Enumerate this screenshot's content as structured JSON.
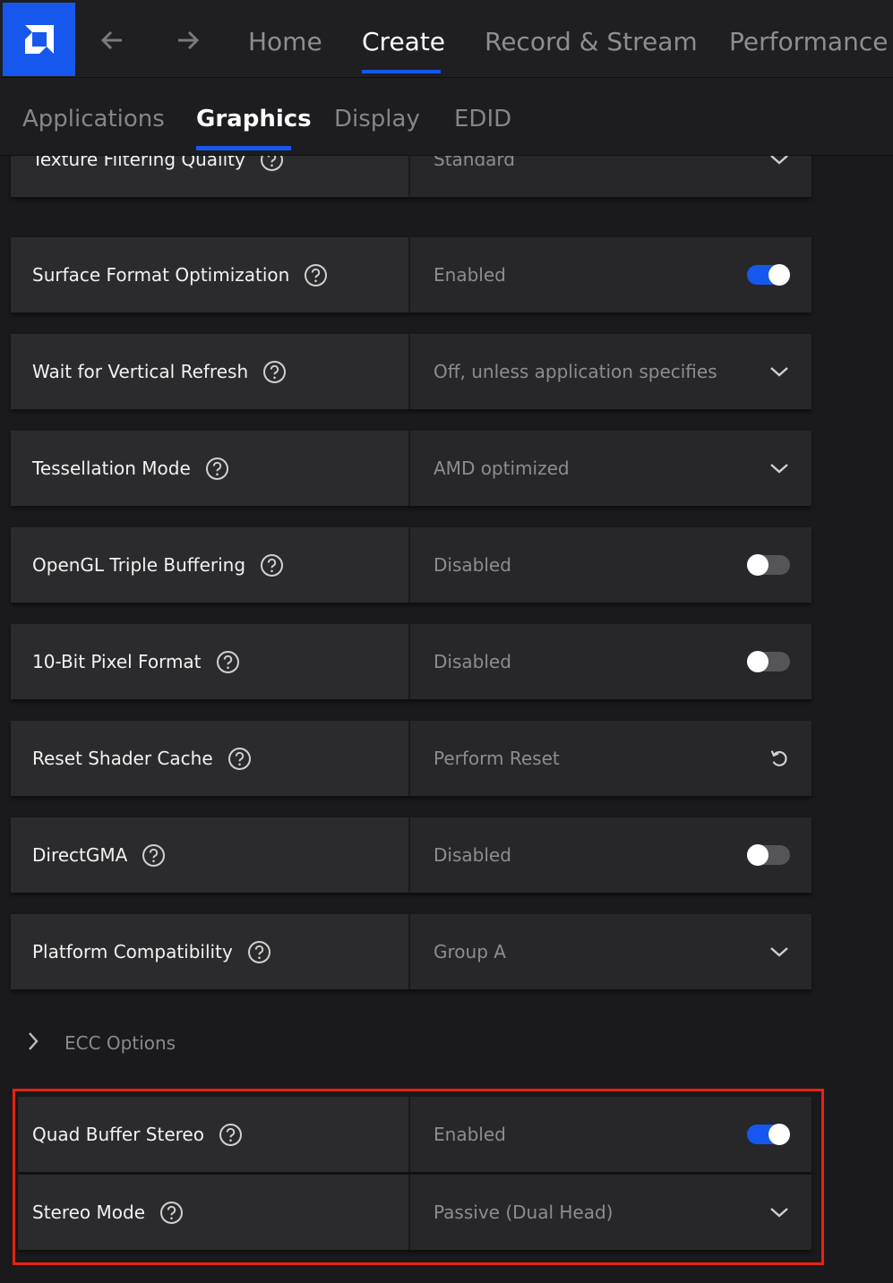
{
  "nav": {
    "back_icon": "arrow-left-icon",
    "forward_icon": "arrow-right-icon",
    "tabs": [
      {
        "label": "Home"
      },
      {
        "label": "Create"
      },
      {
        "label": "Record & Stream"
      },
      {
        "label": "Performance"
      }
    ],
    "active_tab": "Create"
  },
  "subnav": {
    "tabs": [
      {
        "label": "Applications"
      },
      {
        "label": "Graphics"
      },
      {
        "label": "Display"
      },
      {
        "label": "EDID"
      }
    ],
    "active_tab": "Graphics"
  },
  "settings": {
    "texture_filtering": {
      "label": "Texture Filtering Quality",
      "value": "Standard",
      "control": "dropdown"
    },
    "surface_format": {
      "label": "Surface Format Optimization",
      "value": "Enabled",
      "control": "toggle-on"
    },
    "vertical_refresh": {
      "label": "Wait for Vertical Refresh",
      "value": "Off, unless application specifies",
      "control": "dropdown"
    },
    "tessellation": {
      "label": "Tessellation Mode",
      "value": "AMD optimized",
      "control": "dropdown"
    },
    "opengl_triple": {
      "label": "OpenGL Triple Buffering",
      "value": "Disabled",
      "control": "toggle-off"
    },
    "ten_bit": {
      "label": "10-Bit Pixel Format",
      "value": "Disabled",
      "control": "toggle-off"
    },
    "shader_cache": {
      "label": "Reset Shader Cache",
      "value": "Perform Reset",
      "control": "reset"
    },
    "directgma": {
      "label": "DirectGMA",
      "value": "Disabled",
      "control": "toggle-off"
    },
    "platform": {
      "label": "Platform Compatibility",
      "value": "Group A",
      "control": "dropdown"
    }
  },
  "ecc": {
    "label": "ECC Options"
  },
  "stereo": {
    "quad_buffer": {
      "label": "Quad Buffer Stereo",
      "value": "Enabled",
      "control": "toggle-on"
    },
    "stereo_mode": {
      "label": "Stereo Mode",
      "value": "Passive (Dual Head)",
      "control": "dropdown"
    }
  },
  "colors": {
    "accent": "#1658ee",
    "highlight_border": "#e8230f"
  }
}
